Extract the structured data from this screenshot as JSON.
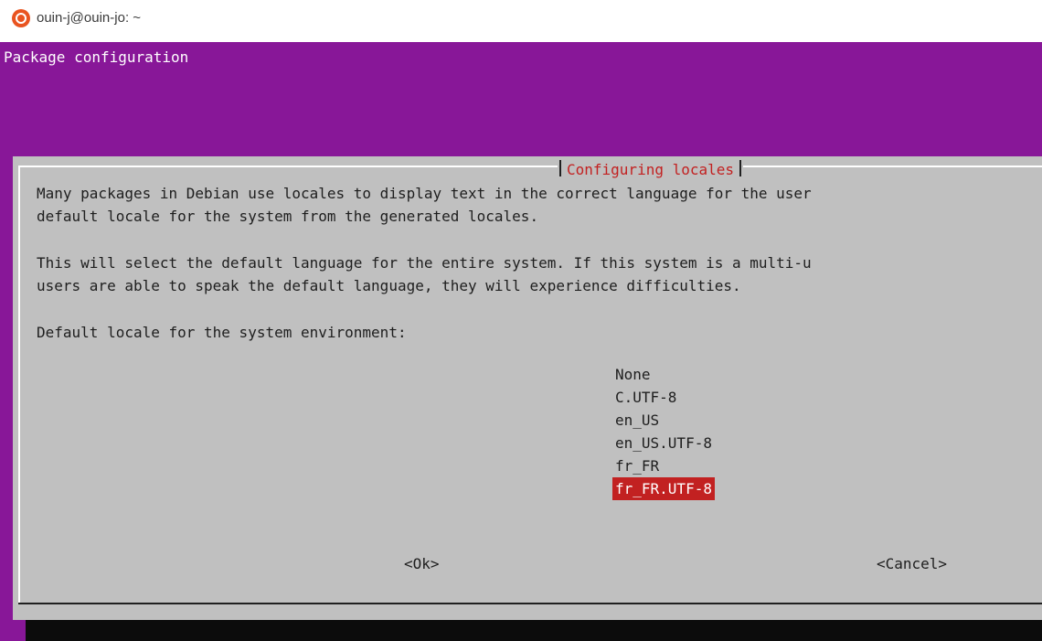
{
  "window": {
    "title": "ouin-j@ouin-jo: ~",
    "icon": "ubuntu-logo-icon"
  },
  "terminal": {
    "backtitle": "Package configuration"
  },
  "dialog": {
    "title": "Configuring locales",
    "lines": [
      "Many packages in Debian use locales to display text in the correct language for the user",
      "default locale for the system from the generated locales.",
      "This will select the default language for the entire system. If this system is a multi-u",
      "users are able to speak the default language, they will experience difficulties.",
      "Default locale for the system environment:"
    ],
    "options": [
      "None",
      "C.UTF-8",
      "en_US",
      "en_US.UTF-8",
      "fr_FR",
      "fr_FR.UTF-8"
    ],
    "selected_option": "fr_FR.UTF-8",
    "ok_label": "<Ok>",
    "cancel_label": "<Cancel>"
  },
  "colors": {
    "terminal_bg": "#881798",
    "dialog_bg": "#c0c0c0",
    "highlight": "#c22121",
    "shadow": "#0c0c0c"
  }
}
